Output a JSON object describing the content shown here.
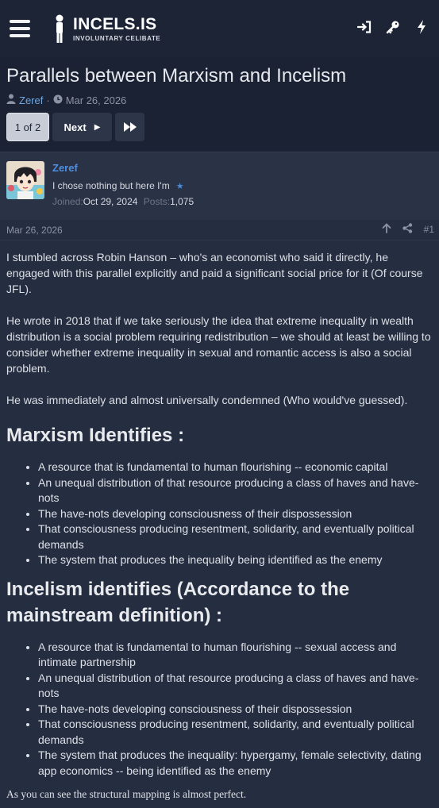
{
  "header": {
    "logo_title": "INCELS.IS",
    "logo_subtitle": "INVOLUNTARY CELIBATE",
    "icons": [
      "login-icon",
      "key-icon",
      "lightning-icon"
    ]
  },
  "thread": {
    "title": "Parallels between Marxism and Incelism",
    "author": "Zeref",
    "date": "Mar 26, 2026",
    "separator": "·"
  },
  "pagination": {
    "current": "1 of 2",
    "next_label": "Next"
  },
  "user": {
    "name": "Zeref",
    "title": "I chose nothing but here I'm",
    "joined_label": "Joined:",
    "joined": "Oct 29, 2024",
    "posts_label": "Posts:",
    "posts": "1,075"
  },
  "post": {
    "date": "Mar 26, 2026",
    "number": "#1",
    "para1": "I stumbled across Robin Hanson – who's an economist who said it directly, he engaged with this parallel explicitly and paid a significant social price for it (Of course JFL).",
    "para2": "He wrote in 2018 that if we take seriously the idea that extreme inequality in wealth distribution is a social problem requiring redistribution – we should at least be willing to consider whether extreme inequality in sexual and romantic access is also a social problem.",
    "para3": "He was immediately and almost universally condemned (Who would've guessed).",
    "heading1": "Marxism Identifies :",
    "list1": [
      "A resource that is fundamental to human flourishing -- economic capital",
      "An unequal distribution of that resource producing a class of haves and have-nots",
      "The have-nots developing consciousness of their dispossession",
      "That consciousness producing resentment, solidarity, and eventually political demands",
      "The system that produces the inequality being identified as the enemy"
    ],
    "heading2": "Incelism identifies (Accordance to the mainstream definition) :",
    "list2": [
      "A resource that is fundamental to human flourishing -- sexual access and intimate partnership",
      "An unequal distribution of that resource producing a class of haves and have-nots",
      "The have-nots developing consciousness of their dispossession",
      "That consciousness producing resentment, solidarity, and eventually political demands",
      "The system that produces the inequality: hypergamy, female selectivity, dating app economics -- being identified as the enemy"
    ],
    "closing": "As you can see the structural mapping is almost perfect."
  },
  "colors": {
    "background": "#252d40",
    "header": "#1d2435",
    "accent": "#4d8fe0"
  }
}
